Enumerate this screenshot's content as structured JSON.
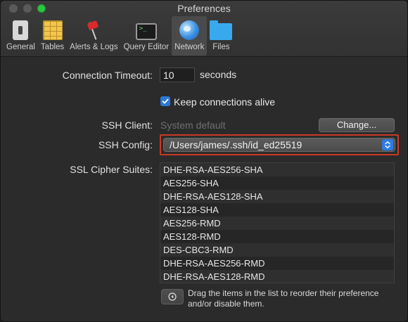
{
  "window": {
    "title": "Preferences"
  },
  "tabs": [
    {
      "label": "General",
      "icon": "general-switch-icon"
    },
    {
      "label": "Tables",
      "icon": "tables-icon"
    },
    {
      "label": "Alerts & Logs",
      "icon": "alerts-flag-icon"
    },
    {
      "label": "Query Editor",
      "icon": "terminal-icon"
    },
    {
      "label": "Network",
      "icon": "globe-icon",
      "active": true
    },
    {
      "label": "Files",
      "icon": "folder-icon"
    }
  ],
  "network": {
    "connection_timeout_label": "Connection Timeout:",
    "connection_timeout_value": "10",
    "timeout_unit": "seconds",
    "keep_alive_label": "Keep connections alive",
    "keep_alive_checked": true,
    "ssh_client_label": "SSH Client:",
    "ssh_client_value": "System default",
    "change_button": "Change...",
    "ssh_config_label": "SSH Config:",
    "ssh_config_value": "/Users/james/.ssh/id_ed25519",
    "ssl_cipher_label": "SSL Cipher Suites:",
    "ssl_ciphers": [
      "DHE-RSA-AES256-SHA",
      "AES256-SHA",
      "DHE-RSA-AES128-SHA",
      "AES128-SHA",
      "AES256-RMD",
      "AES128-RMD",
      "DES-CBC3-RMD",
      "DHE-RSA-AES256-RMD",
      "DHE-RSA-AES128-RMD"
    ],
    "help_text": "Drag the items in the list to reorder their preference and/or disable them."
  },
  "colors": {
    "accent": "#2d78d6",
    "highlight_border": "#c83a26"
  }
}
